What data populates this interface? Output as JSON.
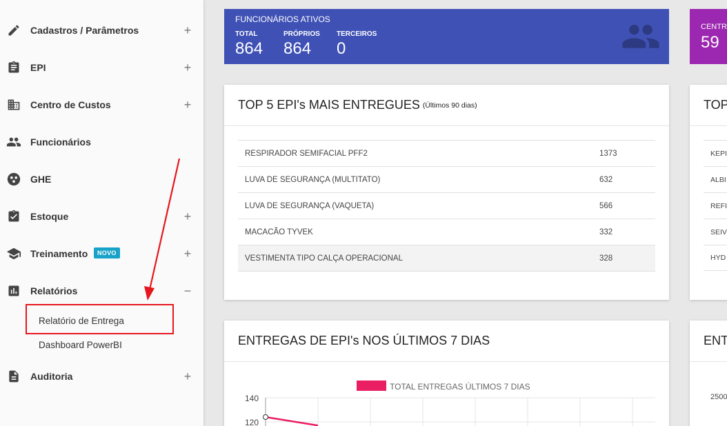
{
  "sidebar": {
    "items": [
      {
        "label": "Cadastros / Parâmetros",
        "icon": "pencil-icon",
        "toggle": "+"
      },
      {
        "label": "EPI",
        "icon": "clipboard-icon",
        "toggle": "+"
      },
      {
        "label": "Centro de Custos",
        "icon": "building-icon",
        "toggle": "+"
      },
      {
        "label": "Funcionários",
        "icon": "people-icon",
        "toggle": ""
      },
      {
        "label": "GHE",
        "icon": "group-icon",
        "toggle": ""
      },
      {
        "label": "Estoque",
        "icon": "clipboard-check-icon",
        "toggle": "+"
      },
      {
        "label": "Treinamento",
        "icon": "graduation-cap-icon",
        "toggle": "+",
        "badge": "NOVO"
      },
      {
        "label": "Relatórios",
        "icon": "bar-chart-icon",
        "toggle": "−"
      },
      {
        "label": "Auditoria",
        "icon": "document-icon",
        "toggle": "+"
      }
    ],
    "submenu": [
      "Relatório de Entrega",
      "Dashboard PowerBI"
    ]
  },
  "stats": {
    "title": "FUNCIONÁRIOS ATIVOS",
    "total_label": "TOTAL",
    "total_value": "864",
    "proprios_label": "PRÓPRIOS",
    "proprios_value": "864",
    "terceiros_label": "TERCEIROS",
    "terceiros_value": "0",
    "second_title": "CENTRO",
    "second_value": "59",
    "icon": "people-icon"
  },
  "top5": {
    "title": "TOP 5 EPI's MAIS ENTREGUES",
    "subtitle": "(Últimos 90 dias)",
    "rows": [
      {
        "name": "RESPIRADOR SEMIFACIAL PFF2",
        "value": "1373"
      },
      {
        "name": "LUVA DE SEGURANÇA (MULTITATO)",
        "value": "632"
      },
      {
        "name": "LUVA DE SEGURANÇA (VAQUETA)",
        "value": "566"
      },
      {
        "name": "MACACÃO TYVEK",
        "value": "332"
      },
      {
        "name": "VESTIMENTA TIPO CALÇA OPERACIONAL",
        "value": "328"
      }
    ]
  },
  "top_side": {
    "title": "TOP",
    "rows": [
      "KEPI",
      "ALBI",
      "REFI",
      "SEIV",
      "HYD"
    ]
  },
  "entregas": {
    "title": "ENTREGAS DE EPI's NOS ÚLTIMOS 7 DIAS"
  },
  "entregas_side": {
    "title": "ENT",
    "tick": "2500"
  },
  "colors": {
    "primary": "#3f51b5",
    "purple": "#9c27b0",
    "chart_line": "#e91e63",
    "badge": "#17a2c8",
    "annotation_red": "#e5161d"
  },
  "chart_data": {
    "type": "line",
    "legend": "TOTAL ENTREGAS ÚLTIMOS 7 DIAS",
    "y_ticks": [
      "140",
      "120"
    ],
    "ylim": [
      0,
      140
    ],
    "series": [
      {
        "name": "TOTAL ENTREGAS ÚLTIMOS 7 DIAS",
        "values": [
          124,
          117
        ]
      }
    ]
  }
}
